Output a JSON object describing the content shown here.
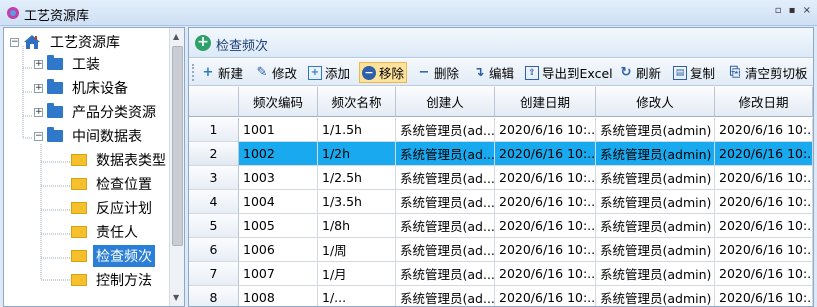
{
  "window": {
    "title": "工艺资源库",
    "controls": "▫ ▪ ×"
  },
  "tree": {
    "root": {
      "label": "工艺资源库"
    },
    "nodes": [
      {
        "label": "工装",
        "expander": "+"
      },
      {
        "label": "机床设备",
        "expander": "+"
      },
      {
        "label": "产品分类资源",
        "expander": "+"
      },
      {
        "label": "中间数据表",
        "expander": "−"
      }
    ],
    "children": [
      {
        "label": "数据表类型"
      },
      {
        "label": "检查位置"
      },
      {
        "label": "反应计划"
      },
      {
        "label": "责任人"
      },
      {
        "label": "检查频次"
      },
      {
        "label": "控制方法"
      }
    ]
  },
  "panel": {
    "title": "检查频次"
  },
  "toolbar": {
    "new": "新建",
    "modify": "修改",
    "add": "添加",
    "remove": "移除",
    "delete": "删除",
    "edit": "编辑",
    "export": "导出到Excel",
    "refresh": "刷新",
    "copy": "复制",
    "clear_clipboard": "清空剪切板"
  },
  "grid": {
    "columns": [
      "频次编码",
      "频次名称",
      "创建人",
      "创建日期",
      "修改人",
      "修改日期"
    ],
    "rows": [
      {
        "num": "1",
        "code": "1001",
        "name": "1/1.5h",
        "creator": "系统管理员(ad...",
        "created": "2020/6/16 10:...",
        "modifier": "系统管理员(admin)",
        "modified": "2020/6/16 10:..."
      },
      {
        "num": "2",
        "code": "1002",
        "name": "1/2h",
        "creator": "系统管理员(ad...",
        "created": "2020/6/16 10:...",
        "modifier": "系统管理员(admin)",
        "modified": "2020/6/16 10:..."
      },
      {
        "num": "3",
        "code": "1003",
        "name": "1/2.5h",
        "creator": "系统管理员(ad...",
        "created": "2020/6/16 10:...",
        "modifier": "系统管理员(admin)",
        "modified": "2020/6/16 10:..."
      },
      {
        "num": "4",
        "code": "1004",
        "name": "1/3.5h",
        "creator": "系统管理员(ad...",
        "created": "2020/6/16 10:...",
        "modifier": "系统管理员(admin)",
        "modified": "2020/6/16 10:..."
      },
      {
        "num": "5",
        "code": "1005",
        "name": "1/8h",
        "creator": "系统管理员(ad...",
        "created": "2020/6/16 10:...",
        "modifier": "系统管理员(admin)",
        "modified": "2020/6/16 10:..."
      },
      {
        "num": "6",
        "code": "1006",
        "name": "1/周",
        "creator": "系统管理员(ad...",
        "created": "2020/6/16 10:...",
        "modifier": "系统管理员(admin)",
        "modified": "2020/6/16 10:..."
      },
      {
        "num": "7",
        "code": "1007",
        "name": "1/月",
        "creator": "系统管理员(ad...",
        "created": "2020/6/16 10:...",
        "modifier": "系统管理员(admin)",
        "modified": "2020/6/16 10:..."
      },
      {
        "num": "8",
        "code": "1008",
        "name": "1/...",
        "creator": "系统管理员(ad...",
        "created": "2020/6/16 10:...",
        "modifier": "系统管理员(admin)",
        "modified": "2020/6/16 10:..."
      }
    ],
    "selected_row": "2"
  },
  "colors": {
    "selected_row": "#19a9ef",
    "tree_selected": "#2b7fd6",
    "active_button": "#fde29c"
  }
}
